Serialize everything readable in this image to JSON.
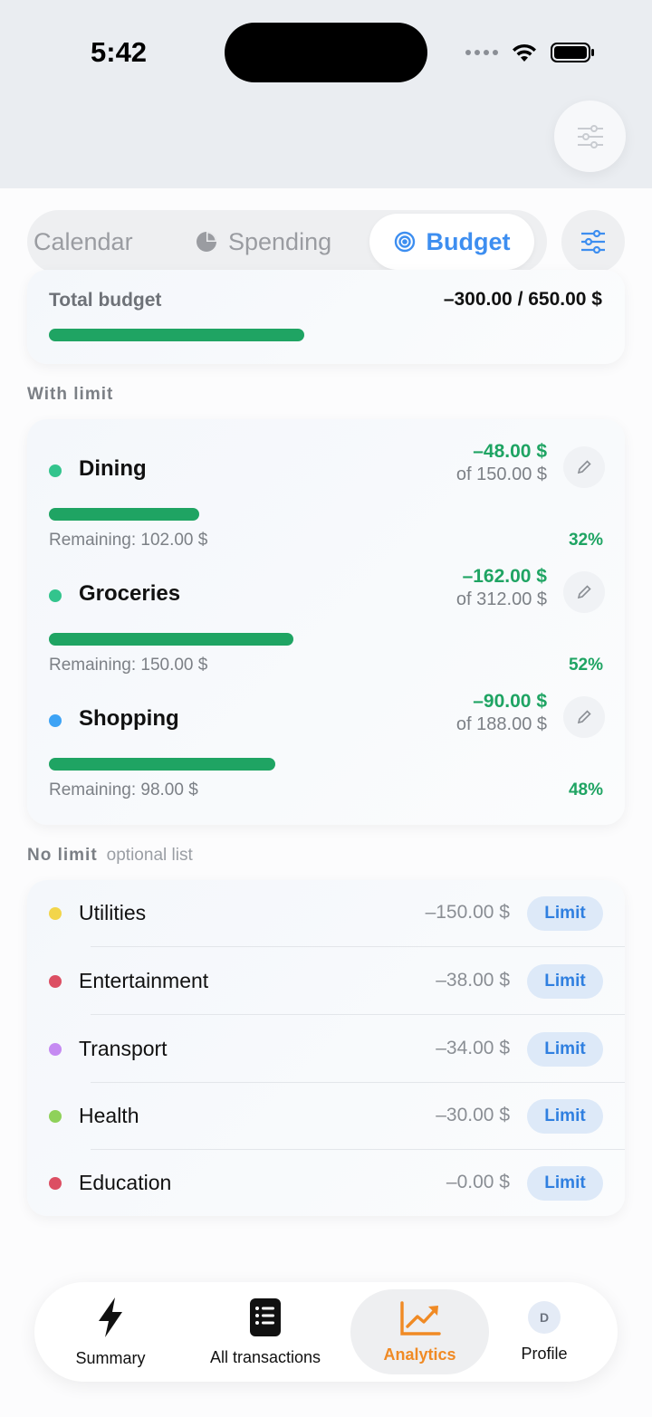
{
  "status_bar": {
    "time": "5:42"
  },
  "tabs": [
    {
      "label": "Calendar",
      "active": false
    },
    {
      "label": "Spending",
      "active": false
    },
    {
      "label": "Budget",
      "active": true
    }
  ],
  "total": {
    "label": "Total budget",
    "value": "–300.00 / 650.00 $",
    "progress": 0.46
  },
  "with_limit": {
    "label": "With limit",
    "items": [
      {
        "name": "Dining",
        "color": "#33c48d",
        "amount": "–48.00 $",
        "of": "of 150.00 $",
        "remaining": "Remaining: 102.00 $",
        "percent": "32%",
        "progress": 0.32
      },
      {
        "name": "Groceries",
        "color": "#33c48d",
        "amount": "–162.00 $",
        "of": "of 312.00 $",
        "remaining": "Remaining: 150.00 $",
        "percent": "52%",
        "progress": 0.52
      },
      {
        "name": "Shopping",
        "color": "#3da3f5",
        "amount": "–90.00 $",
        "of": "of 188.00 $",
        "remaining": "Remaining: 98.00 $",
        "percent": "48%",
        "progress": 0.48
      }
    ]
  },
  "no_limit": {
    "label": "No limit",
    "sublabel": "optional list",
    "button_label": "Limit",
    "items": [
      {
        "name": "Utilities",
        "color": "#f2d54a",
        "amount": "–150.00 $"
      },
      {
        "name": "Entertainment",
        "color": "#dc4f63",
        "amount": "–38.00 $"
      },
      {
        "name": "Transport",
        "color": "#c58af2",
        "amount": "–34.00 $"
      },
      {
        "name": "Health",
        "color": "#8fd15a",
        "amount": "–30.00 $"
      },
      {
        "name": "Education",
        "color": "#dc4f63",
        "amount": "–0.00 $"
      }
    ]
  },
  "bottom_nav": {
    "summary": "Summary",
    "all_transactions": "All transactions",
    "analytics": "Analytics",
    "profile": "Profile",
    "avatar_initial": "D"
  },
  "colors": {
    "accent_blue": "#3d8ef0",
    "accent_green": "#1fa463",
    "accent_orange": "#f08a24"
  }
}
